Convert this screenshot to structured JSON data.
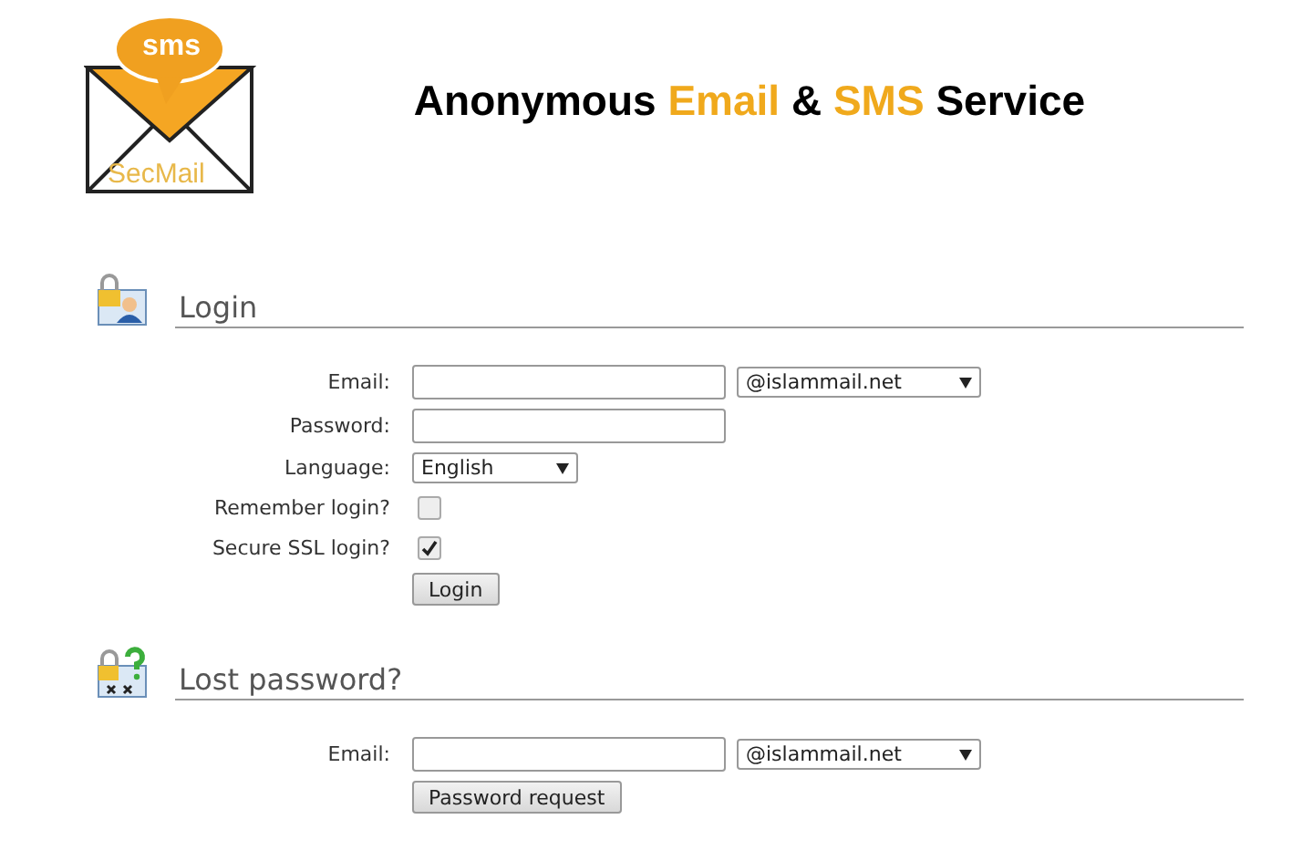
{
  "logo": {
    "bubble": "sms",
    "caption": "SecMail"
  },
  "title": [
    {
      "text": "Anonymous ",
      "kind": "plain"
    },
    {
      "text": "Email",
      "kind": "accent"
    },
    {
      "text": " & ",
      "kind": "plain"
    },
    {
      "text": "SMS",
      "kind": "accent"
    },
    {
      "text": " Service",
      "kind": "plain"
    }
  ],
  "sections": [
    {
      "heading": "Login",
      "kind": "login",
      "rows": [
        {
          "kind": "email",
          "label": "Email:",
          "domain": "@islammail.net"
        },
        {
          "kind": "password",
          "label": "Password:"
        },
        {
          "kind": "select",
          "label": "Language:",
          "value": "English"
        },
        {
          "kind": "checkbox",
          "label": "Remember login?",
          "checked": false
        },
        {
          "kind": "checkbox",
          "label": "Secure SSL login?",
          "checked": true
        },
        {
          "kind": "button",
          "label": "Login"
        }
      ]
    },
    {
      "heading": "Lost password?",
      "kind": "recovery",
      "rows": [
        {
          "kind": "email",
          "label": "Email:",
          "domain": "@islammail.net"
        },
        {
          "kind": "button",
          "label": "Password request"
        }
      ]
    }
  ]
}
